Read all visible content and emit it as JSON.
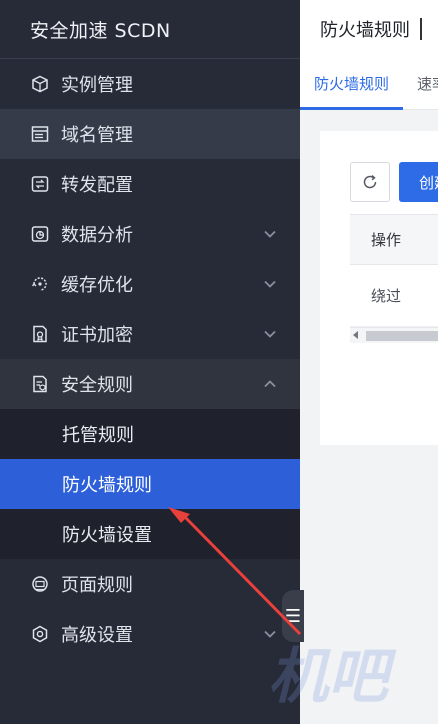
{
  "sidebar": {
    "brand": "安全加速 SCDN",
    "items": [
      {
        "label": "实例管理",
        "icon": "cube-icon"
      },
      {
        "label": "域名管理",
        "icon": "server-icon"
      },
      {
        "label": "转发配置",
        "icon": "forward-icon"
      },
      {
        "label": "数据分析",
        "icon": "chart-icon"
      },
      {
        "label": "缓存优化",
        "icon": "cache-icon"
      },
      {
        "label": "证书加密",
        "icon": "certificate-icon"
      },
      {
        "label": "安全规则",
        "icon": "security-doc-icon"
      },
      {
        "label": "页面规则",
        "icon": "page-icon"
      },
      {
        "label": "高级设置",
        "icon": "settings-icon"
      }
    ],
    "security_sub_items": [
      {
        "label": "托管规则"
      },
      {
        "label": "防火墙规则"
      },
      {
        "label": "防火墙设置"
      }
    ]
  },
  "main": {
    "title": "防火墙规则",
    "tabs": [
      {
        "label": "防火墙规则"
      },
      {
        "label": "速率"
      }
    ],
    "create_label": "创建",
    "table": {
      "header": "操作",
      "rows": [
        "绕过"
      ]
    }
  },
  "watermark": "机吧",
  "colors": {
    "sidebar_bg": "#272a37",
    "selected_bg": "#2c5fd8",
    "accent": "#2e6be6",
    "annotation_arrow": "#e8413c"
  }
}
